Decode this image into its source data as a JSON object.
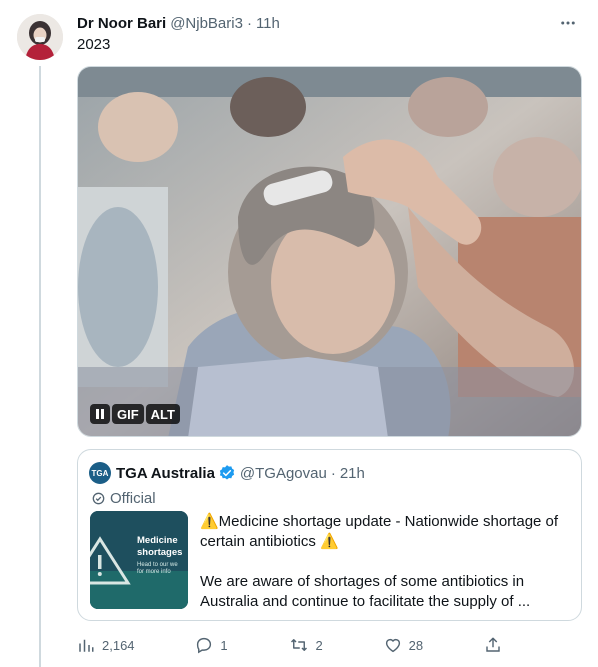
{
  "tweet": {
    "author_name": "Dr Noor Bari",
    "author_handle": "@NjbBari3",
    "separator": "·",
    "time": "11h",
    "text": "2023",
    "more_icon": "more-horizontal-icon"
  },
  "media": {
    "badges": [
      "GIF",
      "ALT"
    ],
    "pause_icon": "pause-icon"
  },
  "quote": {
    "logo_text": "TGA",
    "name": "TGA Australia",
    "handle": "@TGAgovau",
    "separator": "·",
    "time": "21h",
    "label": "Official",
    "thumbnail": {
      "title_line1": "Medicine",
      "title_line2": "shortages",
      "subtitle_line1": "Head to our we",
      "subtitle_line2": "for more info"
    },
    "text_line1": "⚠️Medicine shortage update - Nationwide shortage of certain antibiotics ⚠️",
    "text_line2": "We are aware of shortages of some antibiotics in Australia and continue to facilitate the supply of ..."
  },
  "actions": {
    "views": "2,164",
    "replies": "1",
    "retweets": "2",
    "likes": "28"
  },
  "colors": {
    "text": "#0f1419",
    "secondary": "#536471",
    "border": "#cfd9de",
    "verified": "#1d9bf0"
  }
}
